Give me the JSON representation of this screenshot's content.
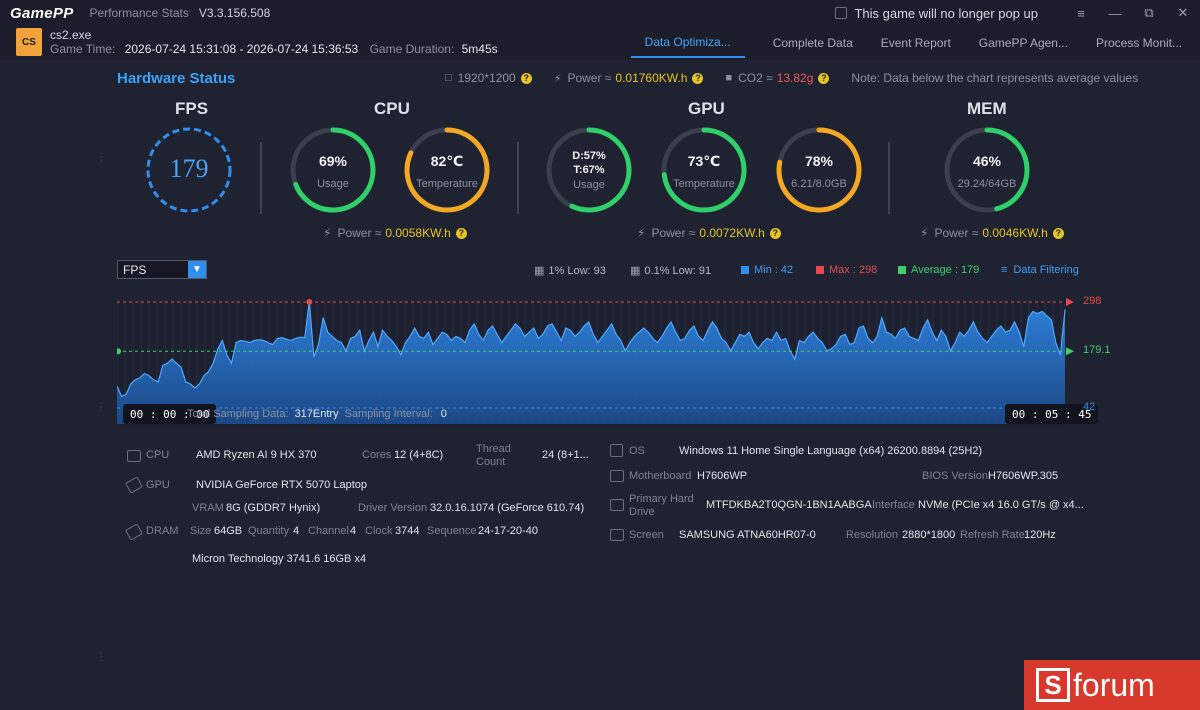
{
  "app": {
    "logo": "GamePP",
    "window_title": "Performance Stats",
    "version": "V3.3.156.508",
    "no_popup_label": "This game will no longer pop up"
  },
  "game": {
    "exe": "cs2.exe",
    "game_time_label": "Game Time:",
    "game_time_value": "2026-07-24 15:31:08 - 2026-07-24 15:36:53",
    "duration_label": "Game Duration:",
    "duration_value": "5m45s"
  },
  "tabs": [
    "Data Optimiza...",
    "Complete Data",
    "Event Report",
    "GamePP Agen...",
    "Process Monit..."
  ],
  "hardware_status": {
    "title": "Hardware Status",
    "resolution": "1920*1200",
    "power_label": "Power ≈",
    "power_value": "0.01760KW.h",
    "co2_label": "CO2 ≈",
    "co2_value": "13.82g",
    "note": "Note: Data below the chart represents average values"
  },
  "sections": {
    "fps": {
      "title": "FPS",
      "value": "179"
    },
    "cpu": {
      "title": "CPU",
      "usage": "69%",
      "usage_label": "Usage",
      "usage_pct": 69,
      "temp": "82℃",
      "temp_label": "Temperature",
      "temp_pct": 82,
      "power_label": "Power ≈",
      "power_value": "0.0058KW.h"
    },
    "gpu": {
      "title": "GPU",
      "usage_d": "D:57%",
      "usage_t": "T:67%",
      "usage_label": "Usage",
      "usage_pct": 57,
      "temp": "73℃",
      "temp_label": "Temperature",
      "temp_pct": 73,
      "vram": "78%",
      "vram_detail": "6.21/8.0GB",
      "vram_pct": 78,
      "power_label": "Power ≈",
      "power_value": "0.0072KW.h"
    },
    "mem": {
      "title": "MEM",
      "usage": "46%",
      "detail": "29.24/64GB",
      "usage_pct": 46,
      "power_label": "Power ≈",
      "power_value": "0.0046KW.h"
    }
  },
  "chart_controls": {
    "selected_metric": "FPS",
    "low1": "1% Low: 93",
    "low01": "0.1% Low: 91",
    "min": "Min : 42",
    "max": "Max : 298",
    "avg": "Average : 179",
    "filtering": "Data Filtering",
    "start_time": "00 : 00 : 00",
    "end_time": "00 : 05 : 45",
    "total_label": "Total Sampling Data:",
    "total_value": "317Entry",
    "interval_label": "Sampling Interval:",
    "interval_value": "0"
  },
  "chart_data": {
    "type": "area",
    "title": "",
    "series": [
      {
        "values": [
          95,
          70,
          75,
          100,
          110,
          115,
          125,
          120,
          110,
          105,
          145,
          150,
          160,
          150,
          140,
          105,
          100,
          90,
          100,
          120,
          130,
          150,
          185,
          205,
          170,
          150,
          200,
          205,
          203,
          200,
          205,
          207,
          205,
          200,
          195,
          210,
          212,
          208,
          205,
          210,
          213,
          212,
          300,
          165,
          195,
          260,
          225,
          215,
          205,
          200,
          180,
          210,
          215,
          230,
          180,
          205,
          225,
          190,
          230,
          215,
          205,
          190,
          170,
          200,
          215,
          235,
          215,
          210,
          225,
          195,
          210,
          225,
          220,
          205,
          215,
          210,
          200,
          230,
          245,
          220,
          205,
          230,
          240,
          220,
          200,
          215,
          230,
          245,
          235,
          215,
          225,
          235,
          210,
          220,
          240,
          245,
          225,
          205,
          235,
          230,
          215,
          225,
          240,
          250,
          220,
          200,
          215,
          230,
          245,
          220,
          205,
          180,
          200,
          215,
          225,
          235,
          225,
          210,
          200,
          215,
          235,
          250,
          225,
          205,
          210,
          230,
          240,
          215,
          205,
          230,
          250,
          235,
          210,
          200,
          180,
          200,
          220,
          215,
          225,
          200,
          185,
          200,
          210,
          205,
          225,
          205,
          210,
          180,
          160,
          205,
          200,
          215,
          225,
          210,
          200,
          180,
          185,
          195,
          215,
          220,
          195,
          200,
          235,
          240,
          210,
          200,
          215,
          260,
          225,
          220,
          210,
          230,
          235,
          215,
          210,
          205,
          235,
          255,
          225,
          205,
          230,
          215,
          180,
          200,
          225,
          215,
          230,
          250,
          225,
          210,
          200,
          215,
          230,
          240,
          225,
          230,
          250,
          225,
          190,
          260,
          275,
          270,
          275,
          265,
          255,
          200,
          170,
          280
        ]
      }
    ],
    "ylim": [
      42,
      298
    ],
    "min": 42,
    "max": 298,
    "average": 179,
    "right_labels": [
      "298",
      "179.1",
      "42"
    ]
  },
  "specs": {
    "cpu_label": "CPU",
    "cpu_value": "AMD Ryzen AI 9 HX 370",
    "cores_label": "Cores",
    "cores_value": "12 (4+8C)",
    "thread_label_1": "Thread",
    "thread_label_2": "Count",
    "thread_value": "24 (8+1...",
    "gpu_label": "GPU",
    "gpu_value": "NVIDIA GeForce RTX 5070 Laptop",
    "vram_label": "VRAM",
    "vram_value": "8G (GDDR7 Hynix)",
    "driver_label": "Driver Version",
    "driver_value": "32.0.16.1074 (GeForce 610.74)",
    "dram_label": "DRAM",
    "size_label": "Size",
    "size_value": "64GB",
    "qty_label": "Quantity",
    "qty_value": "4",
    "channel_label": "Channel",
    "channel_value": "4",
    "clock_label": "Clock",
    "clock_value": "3744",
    "seq_label": "Sequence",
    "seq_value": "24-17-20-40",
    "dram_module": "Micron Technology 3741.6 16GB x4",
    "os_label": "OS",
    "os_value": "Windows 11 Home Single Language (x64) 26200.8894 (25H2)",
    "mb_label": "Motherboard",
    "mb_value": "H7606WP",
    "bios_label": "BIOS Version",
    "bios_value": "H7606WP.305",
    "drive_label_1": "Primary Hard",
    "drive_label_2": "Drive",
    "drive_value": "MTFDKBA2T0QGN-1BN1AABGA",
    "iface_label": "Interface",
    "iface_value": "NVMe (PCIe x4 16.0 GT/s @ x4...",
    "screen_label": "Screen",
    "screen_value": "SAMSUNG ATNA60HR07-0",
    "res_label": "Resolution",
    "res_value": "2880*1800",
    "refresh_label": "Refresh Rate",
    "refresh_value": "120Hz"
  },
  "watermark": "forum"
}
